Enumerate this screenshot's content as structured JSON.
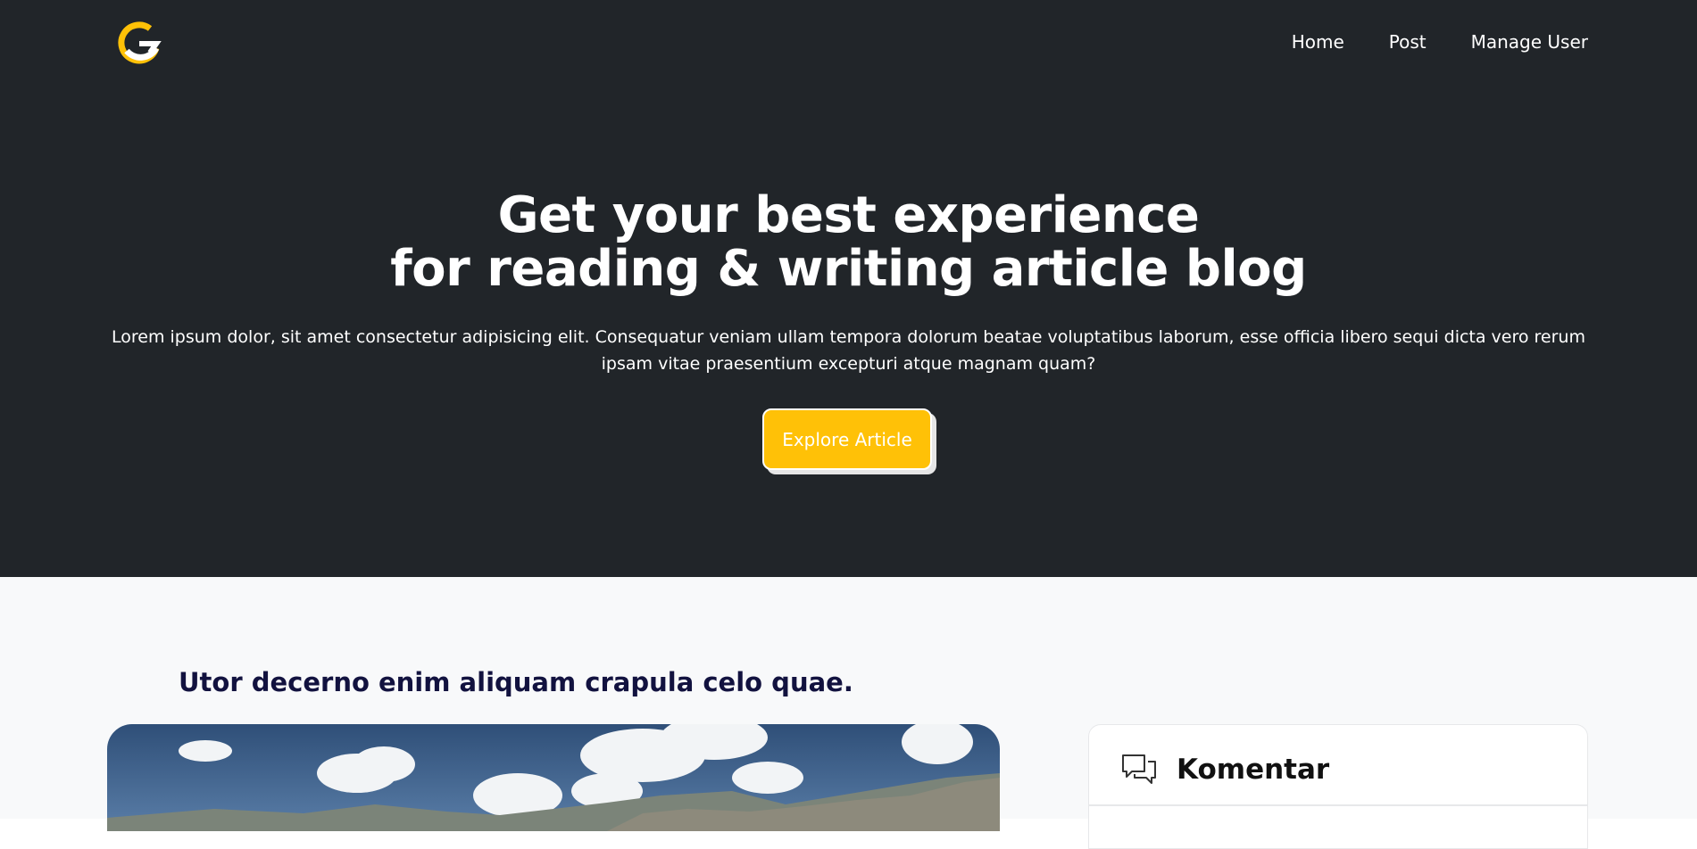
{
  "colors": {
    "hero_background": "#212529",
    "accent": "#ffc107",
    "content_background": "#f8f9fa",
    "article_title": "#12123f"
  },
  "header": {
    "logo_icon": "g-arrow-logo-icon",
    "nav": [
      {
        "label": "Home"
      },
      {
        "label": "Post"
      },
      {
        "label": "Manage User"
      }
    ]
  },
  "hero": {
    "headline_line1": "Get your best experience",
    "headline_line2": "for reading & writing article blog",
    "lede": "Lorem ipsum dolor, sit amet consectetur adipisicing elit. Consequatur veniam ullam tempora dolorum beatae voluptatibus laborum, esse officia libero sequi dicta vero rerum ipsam vitae praesentium excepturi atque magnam quam?",
    "cta_label": "Explore Article"
  },
  "article": {
    "title": "Utor decerno enim aliquam crapula celo quae."
  },
  "comments": {
    "icon": "chat-bubbles-icon",
    "title": "Komentar"
  }
}
